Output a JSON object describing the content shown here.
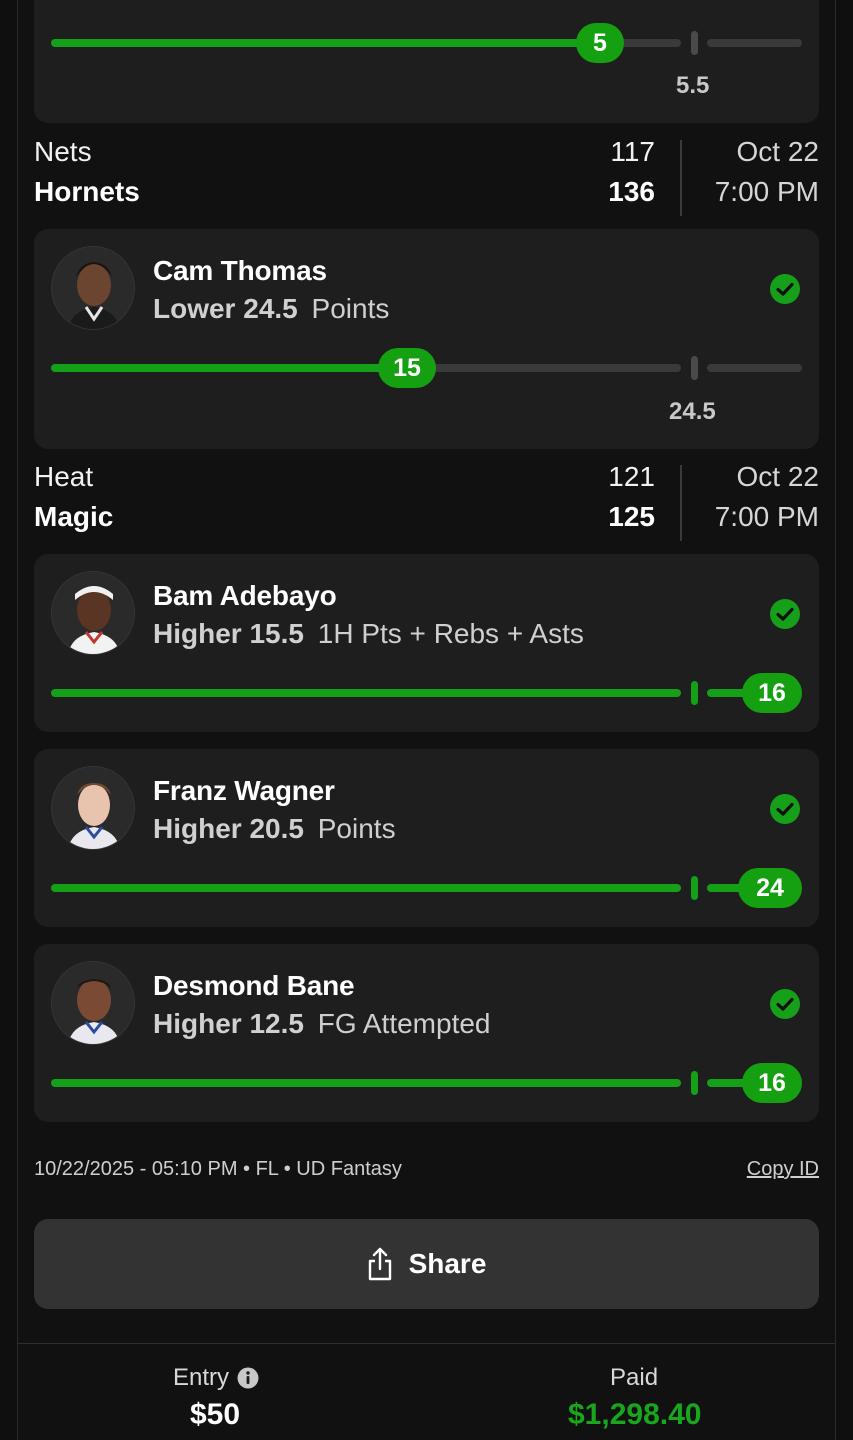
{
  "top_card": {
    "actual": "5",
    "line": "5.5",
    "progress": 0.86
  },
  "games": [
    {
      "team1": "Nets",
      "score1": "117",
      "team2": "Hornets",
      "score2": "136",
      "date": "Oct 22",
      "time": "7:00 PM"
    },
    {
      "team1": "Heat",
      "score1": "121",
      "team2": "Magic",
      "score2": "125",
      "date": "Oct 22",
      "time": "7:00 PM"
    }
  ],
  "picks": [
    {
      "player": "Cam Thomas",
      "direction": "Lower",
      "line": "24.5",
      "stat": "Points",
      "actual": "15",
      "line_label": "24.5",
      "result": "hit"
    },
    {
      "player": "Bam Adebayo",
      "direction": "Higher",
      "line": "15.5",
      "stat": "1H Pts + Rebs + Asts",
      "actual": "16",
      "result": "hit"
    },
    {
      "player": "Franz Wagner",
      "direction": "Higher",
      "line": "20.5",
      "stat": "Points",
      "actual": "24",
      "result": "hit"
    },
    {
      "player": "Desmond Bane",
      "direction": "Higher",
      "line": "12.5",
      "stat": "FG Attempted",
      "actual": "16",
      "result": "hit"
    }
  ],
  "meta": {
    "info": "10/22/2025 - 05:10 PM • FL • UD Fantasy",
    "copy_id": "Copy ID"
  },
  "share": {
    "label": "Share"
  },
  "footer": {
    "entry_label": "Entry",
    "entry_value": "$50",
    "paid_label": "Paid",
    "paid_value": "$1,298.40"
  },
  "colors": {
    "accent_green": "#14a010",
    "paid_green": "#19a61c",
    "card_bg": "#1e1e1e"
  }
}
